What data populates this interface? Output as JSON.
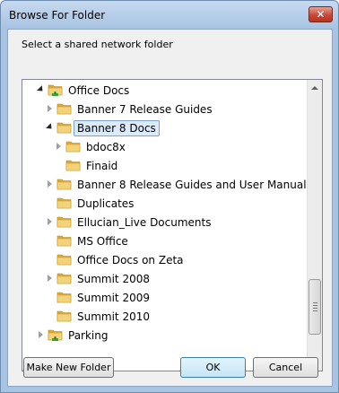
{
  "window": {
    "title": "Browse For Folder",
    "close_label": "✕"
  },
  "instruction": "Select a shared network folder",
  "tree": {
    "items": [
      {
        "label": "Office Docs",
        "level": 0,
        "expander": "expanded",
        "icon": "network-folder-icon"
      },
      {
        "label": "Banner 7 Release Guides",
        "level": 1,
        "expander": "collapsed",
        "icon": "folder-icon"
      },
      {
        "label": "Banner 8 Docs",
        "level": 1,
        "expander": "expanded",
        "icon": "folder-icon",
        "selected": true
      },
      {
        "label": "bdoc8x",
        "level": 2,
        "expander": "collapsed",
        "icon": "folder-icon"
      },
      {
        "label": "Finaid",
        "level": 2,
        "expander": "none",
        "icon": "folder-icon"
      },
      {
        "label": "Banner 8 Release Guides and User Manuals",
        "level": 1,
        "expander": "collapsed",
        "icon": "folder-icon"
      },
      {
        "label": "Duplicates",
        "level": 1,
        "expander": "none",
        "icon": "folder-icon"
      },
      {
        "label": "Ellucian_Live Documents",
        "level": 1,
        "expander": "collapsed",
        "icon": "folder-icon"
      },
      {
        "label": "MS Office",
        "level": 1,
        "expander": "none",
        "icon": "folder-icon"
      },
      {
        "label": "Office Docs on Zeta",
        "level": 1,
        "expander": "none",
        "icon": "folder-icon"
      },
      {
        "label": "Summit 2008",
        "level": 1,
        "expander": "collapsed",
        "icon": "folder-icon"
      },
      {
        "label": "Summit 2009",
        "level": 1,
        "expander": "none",
        "icon": "folder-icon"
      },
      {
        "label": "Summit 2010",
        "level": 1,
        "expander": "none",
        "icon": "folder-icon"
      },
      {
        "label": "Parking",
        "level": 0,
        "expander": "collapsed",
        "icon": "network-folder-icon"
      }
    ]
  },
  "buttons": {
    "make_new_folder": "Make New Folder",
    "ok": "OK",
    "cancel": "Cancel"
  },
  "colors": {
    "selection_bg": "#dcebfc",
    "selection_border": "#7da2ce",
    "folder": "#e8c25a",
    "network_green": "#3aa33a"
  }
}
